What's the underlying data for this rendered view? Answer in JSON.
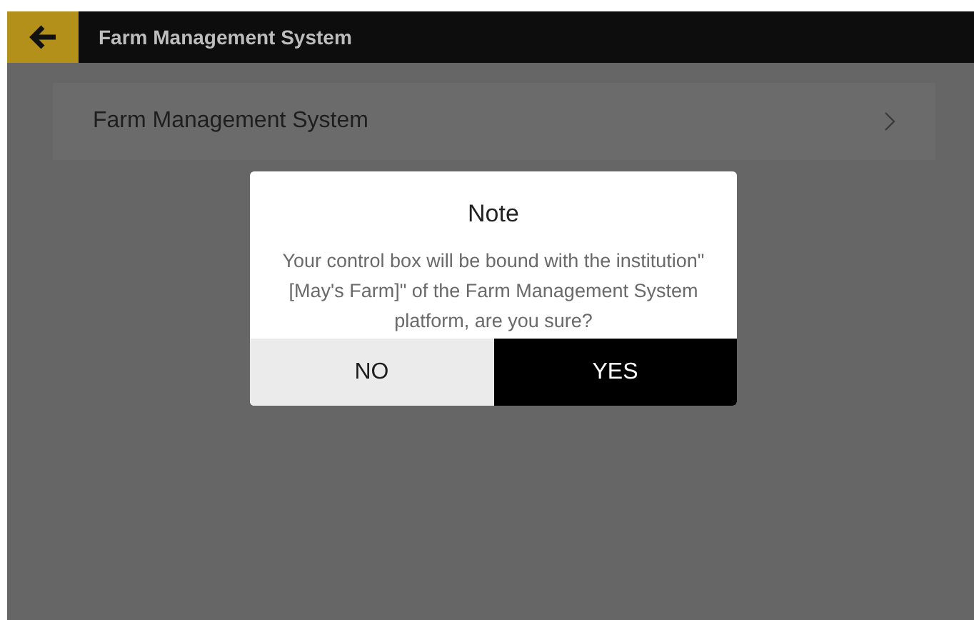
{
  "header": {
    "title": "Farm Management System"
  },
  "list": [
    {
      "label": "Farm Management System"
    }
  ],
  "dialog": {
    "title": "Note",
    "message": "Your control box will be bound with the institution\" [May's Farm]\" of the Farm Management System platform, are you sure?",
    "buttons": [
      {
        "label": "NO",
        "kind": "cancel"
      },
      {
        "label": "YES",
        "kind": "confirm"
      }
    ]
  }
}
